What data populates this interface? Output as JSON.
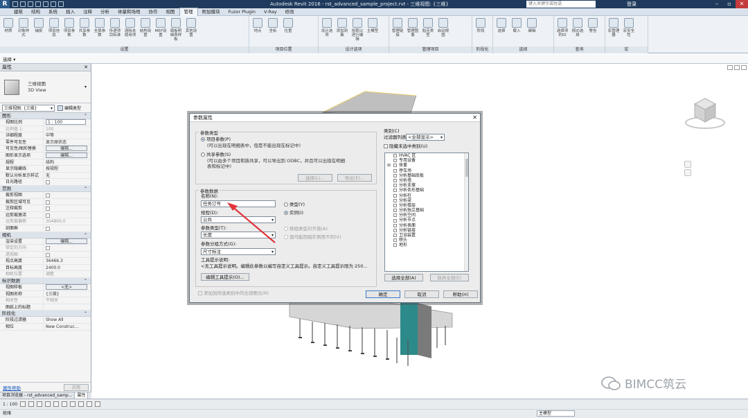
{
  "titlebar": {
    "app_letter": "R",
    "window_title": "Autodesk Revit 2016 - rst_advanced_sample_project.rvt - 三维视图: {三维}",
    "search_placeholder": "键入关键字或短语",
    "login": "登录",
    "min": "–",
    "max": "▫",
    "close": "✕"
  },
  "tabs": [
    "建筑",
    "结构",
    "系统",
    "插入",
    "注释",
    "分析",
    "体量和场地",
    "协作",
    "视图",
    "管理",
    "附加模块",
    "Fuzor Plugin",
    "V-Ray",
    "修改"
  ],
  "active_tab": "管理",
  "ribbon": {
    "groups": [
      {
        "name": "设置",
        "tools": [
          "材质",
          "对象样式",
          "捕捉",
          "项目信息",
          "项目参数",
          "共享参数",
          "全局参数",
          "传递项目标准",
          "清除未使用项",
          "结构设置",
          "MEP设置",
          "面板明细表样板",
          "其他设置"
        ]
      },
      {
        "name": "项目位置",
        "tools": [
          "地点",
          "坐标",
          "位置"
        ]
      },
      {
        "name": "设计选项",
        "tools": [
          "设计选项",
          "添加到集",
          "拾取以进行编辑",
          "主模型"
        ]
      },
      {
        "name": "管理项目",
        "tools": [
          "管理链接",
          "管理图像",
          "贴花类型",
          "启动视图"
        ]
      },
      {
        "name": "阶段化",
        "tools": [
          "阶段"
        ]
      },
      {
        "name": "选择",
        "tools": [
          "选择",
          "载入",
          "编辑"
        ]
      },
      {
        "name": "查询",
        "tools": [
          "选择项的ID",
          "按ID选择",
          "警告"
        ]
      },
      {
        "name": "宏",
        "tools": [
          "宏管理器",
          "宏安全性"
        ]
      }
    ],
    "select_label": "选择 ▾"
  },
  "properties": {
    "title": "属性",
    "close": "✕",
    "type_name_1": "三维视图",
    "type_name_2": "3D View",
    "instance_select": "三维视图: {三维}",
    "edit_type": "编辑类型",
    "sections": [
      {
        "title": "图形",
        "rows": [
          {
            "k": "视图比例",
            "v": "1 : 100",
            "kind": "input"
          },
          {
            "k": "比例值 1:",
            "v": "100",
            "kind": "text",
            "dim": true
          },
          {
            "k": "详细程度",
            "v": "中等",
            "kind": "text"
          },
          {
            "k": "零件可见性",
            "v": "显示原状态",
            "kind": "text"
          },
          {
            "k": "可见性/图形替换",
            "v": "编辑...",
            "kind": "btn"
          },
          {
            "k": "图形显示选项",
            "v": "编辑...",
            "kind": "btn"
          },
          {
            "k": "规程",
            "v": "结构",
            "kind": "text"
          },
          {
            "k": "显示隐藏线",
            "v": "按规程",
            "kind": "text"
          },
          {
            "k": "默认分析显示样式",
            "v": "无",
            "kind": "text"
          },
          {
            "k": "日光路径",
            "v": "",
            "kind": "chk"
          }
        ]
      },
      {
        "title": "范围",
        "rows": [
          {
            "k": "裁剪视图",
            "v": "",
            "kind": "chk"
          },
          {
            "k": "裁剪区域可见",
            "v": "",
            "kind": "chk"
          },
          {
            "k": "注释裁剪",
            "v": "",
            "kind": "chk"
          },
          {
            "k": "远剪裁激活",
            "v": "",
            "kind": "chk"
          },
          {
            "k": "远剪裁偏移",
            "v": "304800.0",
            "kind": "text",
            "dim": true
          },
          {
            "k": "剖面框",
            "v": "",
            "kind": "chk"
          }
        ]
      },
      {
        "title": "相机",
        "rows": [
          {
            "k": "渲染设置",
            "v": "编辑...",
            "kind": "btn"
          },
          {
            "k": "锁定的方向",
            "v": "",
            "kind": "chk",
            "dim": true
          },
          {
            "k": "透视图",
            "v": "",
            "kind": "chk",
            "dim": true
          },
          {
            "k": "视点高度",
            "v": "36466.3",
            "kind": "text"
          },
          {
            "k": "目标高度",
            "v": "2400.0",
            "kind": "text"
          },
          {
            "k": "相机位置",
            "v": "调整",
            "kind": "text",
            "dim": true
          }
        ]
      },
      {
        "title": "标识数据",
        "rows": [
          {
            "k": "视图样板",
            "v": "<无>",
            "kind": "btn"
          },
          {
            "k": "视图名称",
            "v": "{三维}",
            "kind": "text"
          },
          {
            "k": "相关性",
            "v": "不相关",
            "kind": "text",
            "dim": true
          },
          {
            "k": "图纸上的标题",
            "v": "",
            "kind": "text"
          }
        ]
      },
      {
        "title": "阶段化",
        "rows": [
          {
            "k": "阶段过滤器",
            "v": "Show All",
            "kind": "text"
          },
          {
            "k": "相位",
            "v": "New Construc...",
            "kind": "text"
          }
        ]
      }
    ],
    "help_link": "属性帮助",
    "apply": "应用",
    "bottom_tabs": [
      "项目浏览器 - rst_advanced_samp...",
      "属性"
    ]
  },
  "dialog": {
    "title": "参数属性",
    "close": "✕",
    "param_type_legend": "参数类型",
    "project_param": "项目参数(P)",
    "project_param_desc": "(可以出现在明细表中，但是不能出现在标记中)",
    "shared_param": "共享参数(S)",
    "shared_param_desc": "(可以由多个项目和族共享，可以导出到 ODBC，并且可以出现在明细表和标记中)",
    "select_btn": "选择(L)...",
    "export_btn": "导出(E)...",
    "param_data_legend": "参数数据",
    "name_label": "名称(N):",
    "name_value": "任务订号",
    "type_radio": "类型(Y)",
    "instance_radio": "实例(I)",
    "discipline_label": "规程(D):",
    "discipline_value": "公共",
    "param_type_label": "参数类型(T):",
    "param_type_value": "长度",
    "align_by_group": "按组类型对齐值(A)",
    "vary_by_group": "值可能因组实例而不同(V)",
    "group_label": "参数分组方式(G):",
    "group_value": "尺寸标注",
    "tooltip_legend": "工具提示说明:",
    "tooltip_text": "<无工具提示说明。编辑此参数以编写自定义工具提示。自定义工具提示限为 250...",
    "edit_tooltip_btn": "编辑工具提示(O)...",
    "add_to_all": "添加到所选类别中的全部图元(R)",
    "category_legend": "类别(C)",
    "filter_label": "过滤器列表:",
    "filter_value": "<全部显示>",
    "hide_unchecked": "隐藏未选中类别(U)",
    "categories": [
      {
        "name": "HVAC 区",
        "exp": false
      },
      {
        "name": "专用设备",
        "exp": false
      },
      {
        "name": "体量",
        "exp": true
      },
      {
        "name": "停车场",
        "exp": false
      },
      {
        "name": "分析基础底板",
        "exp": false
      },
      {
        "name": "分析墙",
        "exp": false
      },
      {
        "name": "分析支撑",
        "exp": false
      },
      {
        "name": "分析条形基础",
        "exp": false
      },
      {
        "name": "分析柱",
        "exp": false
      },
      {
        "name": "分析梁",
        "exp": false
      },
      {
        "name": "分析楼层",
        "exp": false
      },
      {
        "name": "分析独立基础",
        "exp": false
      },
      {
        "name": "分析空间",
        "exp": false
      },
      {
        "name": "分析节点",
        "exp": false
      },
      {
        "name": "分析表面",
        "exp": false
      },
      {
        "name": "分析链接",
        "exp": false
      },
      {
        "name": "卫浴装置",
        "exp": false
      },
      {
        "name": "喷头",
        "exp": false
      },
      {
        "name": "地形",
        "exp": false
      }
    ],
    "select_all_btn": "选择全部(A)",
    "deselect_all_btn": "放弃全部(E)",
    "ok_btn": "确定",
    "cancel_btn": "取消",
    "help_btn": "帮助(H)"
  },
  "statusbar": {
    "scale": "1 : 100",
    "ready": "就绪",
    "main_model": "主模型"
  },
  "watermark": {
    "text": "BIMCC筑云"
  },
  "colors": {
    "titlebar": "#1f3a5c",
    "ribbon": "#eef2f6",
    "dialog": "#ececec",
    "arrow": "#e0343a",
    "building_teal": "#2d8a8a"
  }
}
